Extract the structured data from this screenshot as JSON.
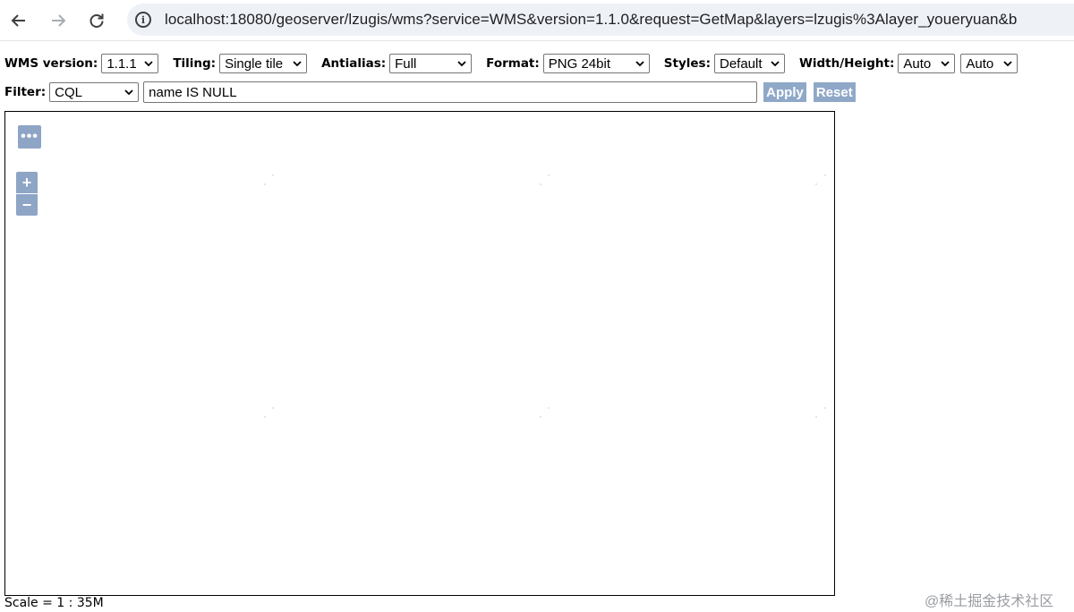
{
  "browser": {
    "back_icon": "back-arrow-icon",
    "forward_icon": "forward-arrow-icon",
    "reload_icon": "reload-icon",
    "url": "localhost:18080/geoserver/lzugis/wms?service=WMS&version=1.1.0&request=GetMap&layers=lzugis%3Alayer_youeryuan&b"
  },
  "toolbar": {
    "wms_version_label": "WMS version:",
    "wms_version_value": "1.1.1",
    "tiling_label": "Tiling:",
    "tiling_value": "Single tile",
    "antialias_label": "Antialias:",
    "antialias_value": "Full",
    "format_label": "Format:",
    "format_value": "PNG 24bit",
    "styles_label": "Styles:",
    "styles_value": "Default",
    "width_height_label": "Width/Height:",
    "width_value": "Auto",
    "height_value": "Auto",
    "filter_label": "Filter:",
    "filter_type_value": "CQL",
    "filter_text": "name IS NULL",
    "apply_label": "Apply",
    "reset_label": "Reset"
  },
  "map": {
    "menu_label": "•••",
    "zoom_in_label": "+",
    "zoom_out_label": "−"
  },
  "footer": {
    "scale_text": "Scale = 1 : 35M",
    "watermark": "@稀土掘金技术社区"
  },
  "colors": {
    "button_bg": "#8fa8c8",
    "omnibox_bg": "#eef1f6"
  }
}
